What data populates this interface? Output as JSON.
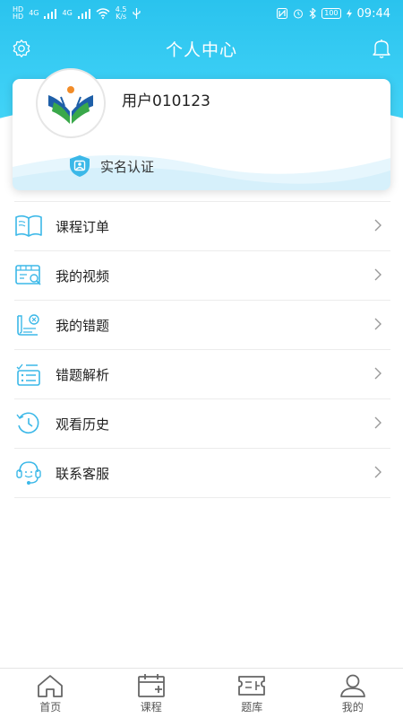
{
  "status_bar": {
    "left_tiny_1": "HD",
    "left_tiny_2": "HD",
    "sig1": "4G",
    "sig2": "4G",
    "speed_value": "4.5",
    "speed_unit": "K/s",
    "battery": "100",
    "time": "09:44"
  },
  "header": {
    "title": "个人中心"
  },
  "profile": {
    "username": "用户010123",
    "verify_label": "实名认证"
  },
  "menu": [
    {
      "label": "课程订单",
      "icon": "book-icon"
    },
    {
      "label": "我的视频",
      "icon": "video-icon"
    },
    {
      "label": "我的错题",
      "icon": "wrong-question-icon"
    },
    {
      "label": "错题解析",
      "icon": "analysis-list-icon"
    },
    {
      "label": "观看历史",
      "icon": "history-icon"
    },
    {
      "label": "联系客服",
      "icon": "customer-service-icon"
    }
  ],
  "tabs": [
    {
      "label": "首页",
      "icon": "home-icon"
    },
    {
      "label": "课程",
      "icon": "calendar-add-icon"
    },
    {
      "label": "题库",
      "icon": "question-bank-icon"
    },
    {
      "label": "我的",
      "icon": "user-icon"
    }
  ],
  "colors": {
    "accent": "#2ac3ee",
    "icon_blue": "#3bb8e8",
    "tab_gray": "#666666"
  }
}
